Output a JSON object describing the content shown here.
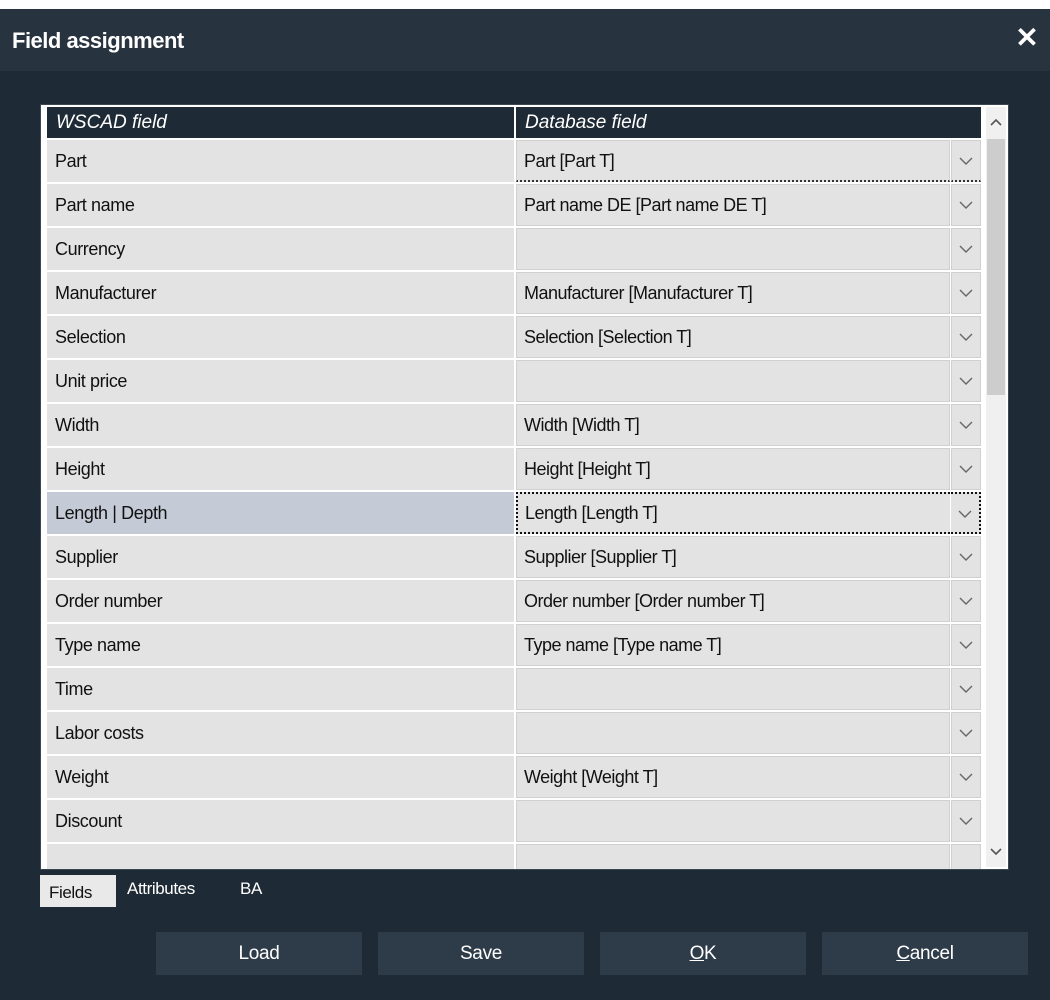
{
  "window": {
    "title": "Field assignment",
    "close_icon": "close-icon"
  },
  "grid": {
    "columns": [
      "WSCAD field",
      "Database field"
    ],
    "rows": [
      {
        "field": "Part",
        "value": "Part [Part T]"
      },
      {
        "field": "Part name",
        "value": "Part name DE [Part name DE T]"
      },
      {
        "field": "Currency",
        "value": ""
      },
      {
        "field": "Manufacturer",
        "value": "Manufacturer [Manufacturer T]"
      },
      {
        "field": "Selection",
        "value": "Selection [Selection T]"
      },
      {
        "field": "Unit price",
        "value": ""
      },
      {
        "field": "Width",
        "value": "Width [Width T]"
      },
      {
        "field": "Height",
        "value": "Height [Height T]"
      },
      {
        "field": "Length | Depth",
        "value": "Length [Length T]"
      },
      {
        "field": "Supplier",
        "value": "Supplier [Supplier T]"
      },
      {
        "field": "Order number",
        "value": "Order number [Order number T]"
      },
      {
        "field": "Type name",
        "value": "Type name [Type name T]"
      },
      {
        "field": "Time",
        "value": ""
      },
      {
        "field": "Labor costs",
        "value": ""
      },
      {
        "field": "Weight",
        "value": "Weight [Weight T]"
      },
      {
        "field": "Discount",
        "value": ""
      }
    ],
    "selected_row": "Length | Depth"
  },
  "tabs": [
    "Fields",
    "Attributes",
    "BA"
  ],
  "active_tab": "Fields",
  "buttons": {
    "load": "Load",
    "save": "Save",
    "ok_mnemonic": "O",
    "ok_rest": "K",
    "cancel_mnemonic": "C",
    "cancel_rest": "ancel"
  },
  "colors": {
    "dialog_bg": "#1e2a35",
    "titlebar_bg": "#27333f",
    "cell_bg": "#e3e3e3",
    "selected_row_bg": "#c5cbd6",
    "button_bg": "#2e3b48"
  }
}
